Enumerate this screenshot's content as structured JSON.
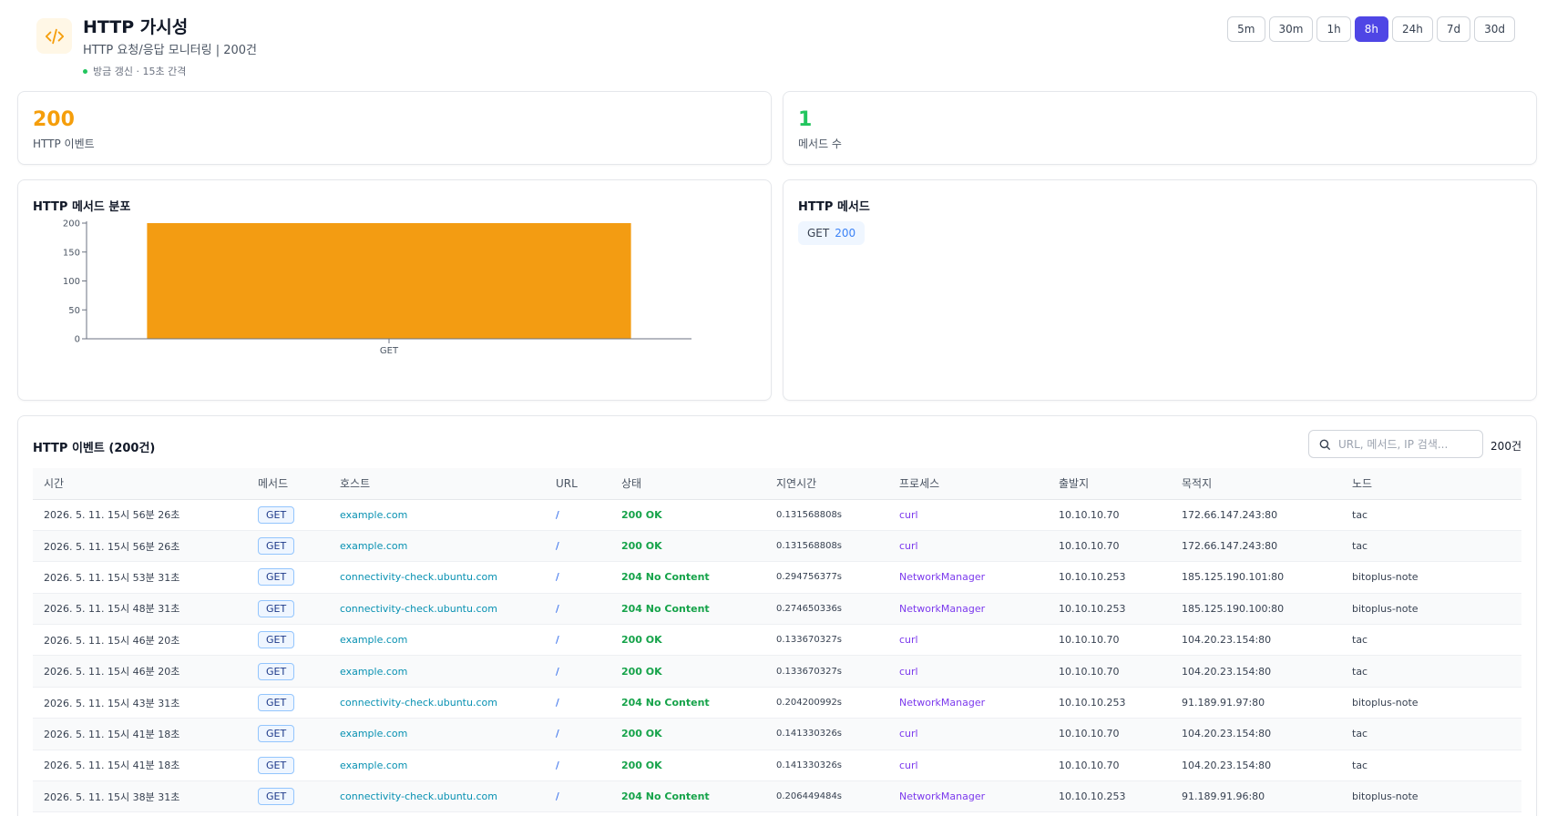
{
  "header": {
    "title": "HTTP 가시성",
    "subtitle": "HTTP 요청/응답 모니터링 | 200건",
    "live_status": "방금 갱신 · 15초 간격",
    "time_ranges": [
      "5m",
      "30m",
      "1h",
      "8h",
      "24h",
      "7d",
      "30d"
    ],
    "active_range": "8h"
  },
  "stats": {
    "events": {
      "value": "200",
      "label": "HTTP 이벤트",
      "color": "#f59e0b"
    },
    "methods": {
      "value": "1",
      "label": "메서드 수",
      "color": "#22c55e"
    }
  },
  "distribution": {
    "title": "HTTP 메서드 분포"
  },
  "chart_data": {
    "type": "bar",
    "categories": [
      "GET"
    ],
    "values": [
      200
    ],
    "title": "HTTP 메서드 분포",
    "xlabel": "",
    "ylabel": "",
    "ylim": [
      0,
      200
    ],
    "yticks": [
      0,
      50,
      100,
      150,
      200
    ],
    "bar_color": "#f39c12",
    "grid": false
  },
  "methods_panel": {
    "title": "HTTP 메서드",
    "chips": [
      {
        "method": "GET",
        "count": "200"
      }
    ]
  },
  "events": {
    "title": "HTTP 이벤트 (200건)",
    "search_placeholder": "URL, 메서드, IP 검색...",
    "count": "200건",
    "columns": [
      "시간",
      "메서드",
      "호스트",
      "URL",
      "상태",
      "지연시간",
      "프로세스",
      "출발지",
      "목적지",
      "노드"
    ],
    "rows": [
      [
        "2026. 5. 11. 15시 56분 26초",
        "GET",
        "example.com",
        "/",
        "200 OK",
        "0.131568808s",
        "curl",
        "10.10.10.70",
        "172.66.147.243:80",
        "tac"
      ],
      [
        "2026. 5. 11. 15시 56분 26초",
        "GET",
        "example.com",
        "/",
        "200 OK",
        "0.131568808s",
        "curl",
        "10.10.10.70",
        "172.66.147.243:80",
        "tac"
      ],
      [
        "2026. 5. 11. 15시 53분 31초",
        "GET",
        "connectivity-check.ubuntu.com",
        "/",
        "204 No Content",
        "0.294756377s",
        "NetworkManager",
        "10.10.10.253",
        "185.125.190.101:80",
        "bitoplus-note"
      ],
      [
        "2026. 5. 11. 15시 48분 31초",
        "GET",
        "connectivity-check.ubuntu.com",
        "/",
        "204 No Content",
        "0.274650336s",
        "NetworkManager",
        "10.10.10.253",
        "185.125.190.100:80",
        "bitoplus-note"
      ],
      [
        "2026. 5. 11. 15시 46분 20초",
        "GET",
        "example.com",
        "/",
        "200 OK",
        "0.133670327s",
        "curl",
        "10.10.10.70",
        "104.20.23.154:80",
        "tac"
      ],
      [
        "2026. 5. 11. 15시 46분 20초",
        "GET",
        "example.com",
        "/",
        "200 OK",
        "0.133670327s",
        "curl",
        "10.10.10.70",
        "104.20.23.154:80",
        "tac"
      ],
      [
        "2026. 5. 11. 15시 43분 31초",
        "GET",
        "connectivity-check.ubuntu.com",
        "/",
        "204 No Content",
        "0.204200992s",
        "NetworkManager",
        "10.10.10.253",
        "91.189.91.97:80",
        "bitoplus-note"
      ],
      [
        "2026. 5. 11. 15시 41분 18초",
        "GET",
        "example.com",
        "/",
        "200 OK",
        "0.141330326s",
        "curl",
        "10.10.10.70",
        "104.20.23.154:80",
        "tac"
      ],
      [
        "2026. 5. 11. 15시 41분 18초",
        "GET",
        "example.com",
        "/",
        "200 OK",
        "0.141330326s",
        "curl",
        "10.10.10.70",
        "104.20.23.154:80",
        "tac"
      ],
      [
        "2026. 5. 11. 15시 38분 31초",
        "GET",
        "connectivity-check.ubuntu.com",
        "/",
        "204 No Content",
        "0.206449484s",
        "NetworkManager",
        "10.10.10.253",
        "91.189.91.96:80",
        "bitoplus-note"
      ]
    ]
  }
}
